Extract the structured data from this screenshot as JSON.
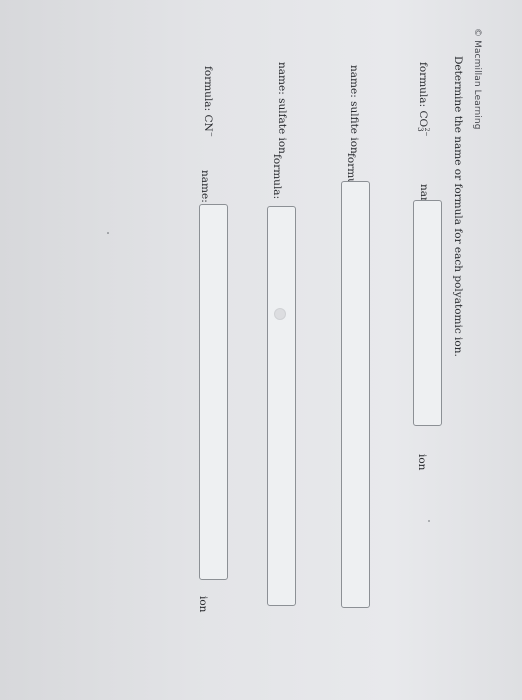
{
  "brand": {
    "name": "Macmillan Learning"
  },
  "question": {
    "prompt": "Determine the name or formula for each polyatomic ion."
  },
  "rows": [
    {
      "given_label": "formula:",
      "given_base": "CO",
      "given_sub": "3",
      "given_sup": "2−",
      "answer_label": "name:",
      "suffix": "ion"
    },
    {
      "given_label": "name:",
      "given_value": "sulfite ion",
      "answer_label": "formula:"
    },
    {
      "given_label": "name:",
      "given_value": "sulfate ion",
      "answer_label": "formula:"
    },
    {
      "given_label": "formula:",
      "given_base": "CN",
      "given_sup": "−",
      "answer_label": "name:",
      "suffix": "ion"
    }
  ]
}
